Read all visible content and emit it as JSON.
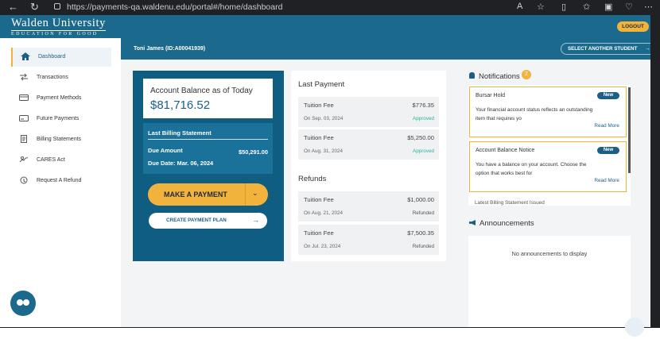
{
  "browser": {
    "url": "https://payments-qa.waldenu.edu/portal#/home/dashboard",
    "back_icon": "←",
    "reload_icon": "↻"
  },
  "header": {
    "logo_line1": "Walden University",
    "logo_line2": "EDUCATION FOR GOOD",
    "logout_label": "LOGOUT"
  },
  "student_bar": {
    "student": "Toni James (ID:A00041939)",
    "select_label": "SELECT ANOTHER STUDENT",
    "select_arrow": "→"
  },
  "sidebar": {
    "items": [
      {
        "label": "Dashboard",
        "icon": "home-icon",
        "active": true
      },
      {
        "label": "Transactions",
        "icon": "transactions-icon"
      },
      {
        "label": "Payment Methods",
        "icon": "card-icon"
      },
      {
        "label": "Future Payments",
        "icon": "calendar-card-icon"
      },
      {
        "label": "Billing Statements",
        "icon": "statement-icon"
      },
      {
        "label": "CARES Act",
        "icon": "cares-icon"
      },
      {
        "label": "Request A Refund",
        "icon": "refund-icon"
      }
    ]
  },
  "balance": {
    "title": "Account Balance as of Today",
    "amount": "$81,716.52",
    "statement_title": "Last Billing Statement",
    "due_label": "Due Amount",
    "due_amount": "$50,291.00",
    "due_date": "Due Date: Mar. 06, 2024",
    "pay_label": "MAKE A PAYMENT",
    "pay_chevron": "⌄",
    "plan_label": "CREATE PAYMENT PLAN",
    "plan_arrow": "→"
  },
  "last_payment": {
    "title": "Last Payment",
    "rows": [
      {
        "name": "Tuition Fee",
        "amount": "$776.35",
        "date": "On Sep. 03, 2024",
        "status": "Approved"
      },
      {
        "name": "Tuition Fee",
        "amount": "$5,250.00",
        "date": "On Aug. 31, 2024",
        "status": "Approved"
      }
    ]
  },
  "refunds": {
    "title": "Refunds",
    "rows": [
      {
        "name": "Tuition Fee",
        "amount": "$1,000.00",
        "date": "On Aug. 21, 2024",
        "status": "Refunded"
      },
      {
        "name": "Tuition Fee",
        "amount": "$7,500.35",
        "date": "On Jul. 23, 2024",
        "status": "Refunded"
      }
    ]
  },
  "notifications": {
    "title": "Notifications",
    "count": "2",
    "items": [
      {
        "title": "Bursar Hold",
        "badge": "New",
        "body": "Your financial account status reflects an outstanding item that requires yo",
        "more": "Read More"
      },
      {
        "title": "Account Balance Notice",
        "badge": "New",
        "body": "You have a balance on your account.  Choose the option that works best for",
        "more": "Read More"
      }
    ],
    "peek": "Latest Billing Statement Issued"
  },
  "announcements": {
    "title": "Announcements",
    "empty": "No announcements to display"
  },
  "colors": {
    "brand": "#1b6a8d",
    "panel": "#0f5e82",
    "accent": "#f2b33d",
    "approved": "#2bb39a"
  }
}
